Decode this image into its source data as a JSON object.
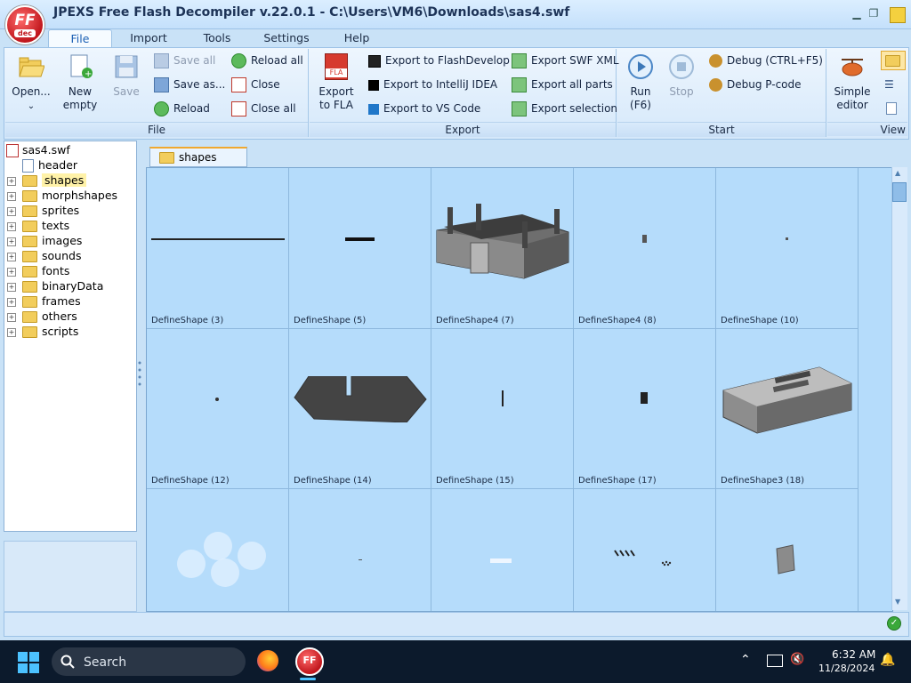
{
  "window": {
    "title": "JPEXS Free Flash Decompiler v.22.0.1 - C:\\Users\\VM6\\Downloads\\sas4.swf",
    "logo_top": "FF",
    "logo_bottom": "dec"
  },
  "menu": [
    "File",
    "Import",
    "Tools",
    "Settings",
    "Help"
  ],
  "ribbon": {
    "file_group": {
      "label": "File",
      "open": "Open...",
      "new_line1": "New",
      "new_line2": "empty",
      "save": "Save",
      "save_all": "Save all",
      "save_as": "Save as...",
      "reload": "Reload",
      "reload_all": "Reload all",
      "close": "Close",
      "close_all": "Close all"
    },
    "export_group": {
      "label": "Export",
      "export_fla_line1": "Export",
      "export_fla_line2": "to FLA",
      "fla_badge": "FLA",
      "flashdevelop": "Export to FlashDevelop",
      "intellij": "Export to IntelliJ IDEA",
      "vscode": "Export to VS Code",
      "swf_xml": "Export SWF XML",
      "all_parts": "Export all parts",
      "selection": "Export selection"
    },
    "start_group": {
      "label": "Start",
      "run_line1": "Run",
      "run_line2": "(F6)",
      "stop": "Stop",
      "debug": "Debug (CTRL+F5)",
      "debug_pcode": "Debug P-code"
    },
    "view_group": {
      "label": "View",
      "simple_line1": "Simple",
      "simple_line2": "editor"
    }
  },
  "tree": {
    "root": "sas4.swf",
    "items": [
      "header",
      "shapes",
      "morphshapes",
      "sprites",
      "texts",
      "images",
      "sounds",
      "fonts",
      "binaryData",
      "frames",
      "others",
      "scripts"
    ]
  },
  "content": {
    "tab_label": "shapes",
    "cells": [
      "DefineShape (3)",
      "DefineShape (5)",
      "DefineShape4 (7)",
      "DefineShape4 (8)",
      "DefineShape (10)",
      "DefineShape (12)",
      "DefineShape (14)",
      "DefineShape (15)",
      "DefineShape (17)",
      "DefineShape3 (18)",
      "",
      "",
      "",
      "",
      ""
    ]
  },
  "taskbar": {
    "search": "Search",
    "time": "6:32 AM",
    "date": "11/28/2024"
  },
  "colors": {
    "accent": "#1b5fb4",
    "grid_bg": "#b5dcfb",
    "selection": "#fff2a8"
  }
}
